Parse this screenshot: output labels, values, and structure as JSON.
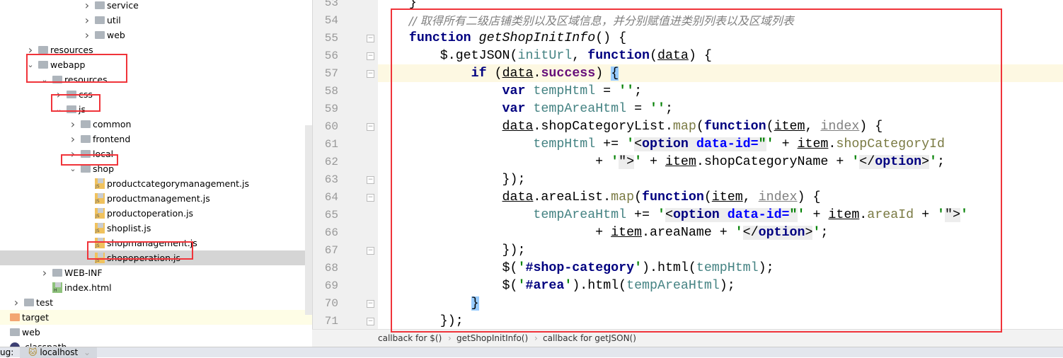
{
  "project_tree": {
    "items": [
      {
        "label": "service",
        "depth": 5,
        "type": "folder",
        "expanded": false
      },
      {
        "label": "util",
        "depth": 5,
        "type": "folder",
        "expanded": false
      },
      {
        "label": "web",
        "depth": 5,
        "type": "folder",
        "expanded": false
      },
      {
        "label": "resources",
        "depth": 1,
        "type": "folder",
        "expanded": false
      },
      {
        "label": "webapp",
        "depth": 1,
        "type": "folder",
        "expanded": true
      },
      {
        "label": "resources",
        "depth": 2,
        "type": "folder",
        "expanded": true
      },
      {
        "label": "css",
        "depth": 3,
        "type": "folder",
        "expanded": false
      },
      {
        "label": "js",
        "depth": 3,
        "type": "folder",
        "expanded": true
      },
      {
        "label": "common",
        "depth": 4,
        "type": "folder",
        "expanded": false
      },
      {
        "label": "frontend",
        "depth": 4,
        "type": "folder",
        "expanded": false
      },
      {
        "label": "local",
        "depth": 4,
        "type": "folder",
        "expanded": false
      },
      {
        "label": "shop",
        "depth": 4,
        "type": "folder",
        "expanded": true
      },
      {
        "label": "productcategorymanagement.js",
        "depth": 5,
        "type": "js"
      },
      {
        "label": "productmanagement.js",
        "depth": 5,
        "type": "js"
      },
      {
        "label": "productoperation.js",
        "depth": 5,
        "type": "js"
      },
      {
        "label": "shoplist.js",
        "depth": 5,
        "type": "js"
      },
      {
        "label": "shopmanagement.js",
        "depth": 5,
        "type": "js"
      },
      {
        "label": "shopoperation.js",
        "depth": 5,
        "type": "js",
        "selected": true
      },
      {
        "label": "WEB-INF",
        "depth": 2,
        "type": "folder",
        "expanded": false
      },
      {
        "label": "index.html",
        "depth": 2,
        "type": "html"
      },
      {
        "label": "test",
        "depth": 0,
        "type": "folder",
        "expanded": false
      },
      {
        "label": "target",
        "depth": -1,
        "type": "folder-orange",
        "highlighted": true
      },
      {
        "label": "web",
        "depth": -1,
        "type": "folder"
      },
      {
        "label": ".classpath",
        "depth": -1,
        "type": "classpath"
      }
    ],
    "js_icon_text": "JS",
    "html_icon_text": "H"
  },
  "editor": {
    "current_line": 57,
    "lines": [
      {
        "n": 53,
        "fold": false,
        "tokens": [
          [
            "    }",
            ""
          ]
        ]
      },
      {
        "n": 54,
        "fold": false,
        "tokens": [
          [
            "    ",
            ""
          ],
          [
            "// 取得所有二级店铺类别以及区域信息，并分别赋值进类别列表以及区域列表",
            "c"
          ]
        ]
      },
      {
        "n": 55,
        "fold": true,
        "tokens": [
          [
            "    ",
            ""
          ],
          [
            "function",
            "k"
          ],
          [
            " ",
            ""
          ],
          [
            "getShopInitInfo",
            "f"
          ],
          [
            "() {",
            ""
          ]
        ]
      },
      {
        "n": 56,
        "fold": true,
        "tokens": [
          [
            "        $.getJSON(",
            ""
          ],
          [
            "initUrl",
            "v"
          ],
          [
            ", ",
            ""
          ],
          [
            "function",
            "k"
          ],
          [
            "(",
            ""
          ],
          [
            "data",
            "u"
          ],
          [
            ") {",
            ""
          ]
        ]
      },
      {
        "n": 57,
        "fold": true,
        "tokens": [
          [
            "            ",
            ""
          ],
          [
            "if",
            "k"
          ],
          [
            " (",
            ""
          ],
          [
            "data",
            "u"
          ],
          [
            ".",
            ""
          ],
          [
            "success",
            "pu"
          ],
          [
            ") ",
            ""
          ],
          [
            "{",
            "br"
          ]
        ]
      },
      {
        "n": 58,
        "fold": false,
        "tokens": [
          [
            "                ",
            ""
          ],
          [
            "var",
            "k"
          ],
          [
            " ",
            ""
          ],
          [
            "tempHtml",
            "v"
          ],
          [
            " = ",
            ""
          ],
          [
            "''",
            "s"
          ],
          [
            ";",
            ""
          ]
        ]
      },
      {
        "n": 59,
        "fold": false,
        "tokens": [
          [
            "                ",
            ""
          ],
          [
            "var",
            "k"
          ],
          [
            " ",
            ""
          ],
          [
            "tempAreaHtml",
            "v"
          ],
          [
            " = ",
            ""
          ],
          [
            "''",
            "s"
          ],
          [
            ";",
            ""
          ]
        ]
      },
      {
        "n": 60,
        "fold": true,
        "tokens": [
          [
            "                ",
            ""
          ],
          [
            "data",
            "u"
          ],
          [
            ".shopCategoryList.",
            ""
          ],
          [
            "map",
            "pr"
          ],
          [
            "(",
            ""
          ],
          [
            "function",
            "k"
          ],
          [
            "(",
            ""
          ],
          [
            "item",
            "u"
          ],
          [
            ", ",
            ""
          ],
          [
            "index",
            "ug"
          ],
          [
            ") {",
            ""
          ]
        ]
      },
      {
        "n": 61,
        "fold": false,
        "tokens": [
          [
            "                    ",
            ""
          ],
          [
            "tempHtml",
            "v"
          ],
          [
            " += ",
            ""
          ],
          [
            "'",
            "s"
          ],
          [
            "<",
            "p"
          ],
          [
            "option",
            "t"
          ],
          [
            " ",
            "p"
          ],
          [
            "data-id=",
            "a"
          ],
          [
            "\"",
            "sh"
          ],
          [
            "'",
            "s"
          ],
          [
            " + ",
            ""
          ],
          [
            "item",
            "u"
          ],
          [
            ".",
            ""
          ],
          [
            "shopCategoryId",
            "pr"
          ]
        ]
      },
      {
        "n": 62,
        "fold": false,
        "tokens": [
          [
            "                            + ",
            ""
          ],
          [
            "'",
            "s"
          ],
          [
            "\">",
            "p"
          ],
          [
            "'",
            "s"
          ],
          [
            " + ",
            ""
          ],
          [
            "item",
            "u"
          ],
          [
            ".shopCategoryName + ",
            ""
          ],
          [
            "'",
            "s"
          ],
          [
            "</",
            "p"
          ],
          [
            "option",
            "t"
          ],
          [
            ">",
            "p"
          ],
          [
            "'",
            "s"
          ],
          [
            ";",
            ""
          ]
        ]
      },
      {
        "n": 63,
        "fold": true,
        "tokens": [
          [
            "                });",
            ""
          ]
        ]
      },
      {
        "n": 64,
        "fold": true,
        "tokens": [
          [
            "                ",
            ""
          ],
          [
            "data",
            "u"
          ],
          [
            ".areaList.",
            ""
          ],
          [
            "map",
            "pr"
          ],
          [
            "(",
            ""
          ],
          [
            "function",
            "k"
          ],
          [
            "(",
            ""
          ],
          [
            "item",
            "u"
          ],
          [
            ", ",
            ""
          ],
          [
            "index",
            "ug"
          ],
          [
            ") {",
            ""
          ]
        ]
      },
      {
        "n": 65,
        "fold": false,
        "tokens": [
          [
            "                    ",
            ""
          ],
          [
            "tempAreaHtml",
            "v"
          ],
          [
            " += ",
            ""
          ],
          [
            "'",
            "s"
          ],
          [
            "<",
            "p"
          ],
          [
            "option",
            "t"
          ],
          [
            " ",
            "p"
          ],
          [
            "data-id=",
            "a"
          ],
          [
            "\"",
            "sh"
          ],
          [
            "'",
            "s"
          ],
          [
            " + ",
            ""
          ],
          [
            "item",
            "u"
          ],
          [
            ".",
            ""
          ],
          [
            "areaId",
            "pr"
          ],
          [
            " + ",
            ""
          ],
          [
            "'",
            "s"
          ],
          [
            "\">",
            "p"
          ],
          [
            "'",
            "s"
          ]
        ]
      },
      {
        "n": 66,
        "fold": false,
        "tokens": [
          [
            "                            + ",
            ""
          ],
          [
            "item",
            "u"
          ],
          [
            ".areaName + ",
            ""
          ],
          [
            "'",
            "s"
          ],
          [
            "</",
            "p"
          ],
          [
            "option",
            "t"
          ],
          [
            ">",
            "p"
          ],
          [
            "'",
            "s"
          ],
          [
            ";",
            ""
          ]
        ]
      },
      {
        "n": 67,
        "fold": true,
        "tokens": [
          [
            "                });",
            ""
          ]
        ]
      },
      {
        "n": 68,
        "fold": false,
        "tokens": [
          [
            "                $(",
            ""
          ],
          [
            "'",
            "s"
          ],
          [
            "#shop-category",
            "sel-i"
          ],
          [
            "'",
            "s"
          ],
          [
            ").html(",
            ""
          ],
          [
            "tempHtml",
            "v"
          ],
          [
            ");",
            ""
          ]
        ]
      },
      {
        "n": 69,
        "fold": false,
        "tokens": [
          [
            "                $(",
            ""
          ],
          [
            "'",
            "s"
          ],
          [
            "#area",
            "sel-i"
          ],
          [
            "'",
            "s"
          ],
          [
            ").html(",
            ""
          ],
          [
            "tempAreaHtml",
            "v"
          ],
          [
            ");",
            ""
          ]
        ]
      },
      {
        "n": 70,
        "fold": true,
        "tokens": [
          [
            "            ",
            ""
          ],
          [
            "}",
            "br"
          ]
        ]
      },
      {
        "n": 71,
        "fold": true,
        "tokens": [
          [
            "        });",
            ""
          ]
        ]
      }
    ]
  },
  "breadcrumb": {
    "items": [
      "callback for $()",
      "getShopInitInfo()",
      "callback for getJSON()"
    ],
    "separator": "›"
  },
  "bottom_bar": {
    "label": "ug:",
    "tab": "localhost",
    "tab_close": "⌄"
  },
  "colors": {
    "annotation_red": "#f0343a",
    "selection": "#d5d5d5",
    "current_line": "#fdf8e2",
    "keyword": "#000080",
    "string": "#008000"
  }
}
